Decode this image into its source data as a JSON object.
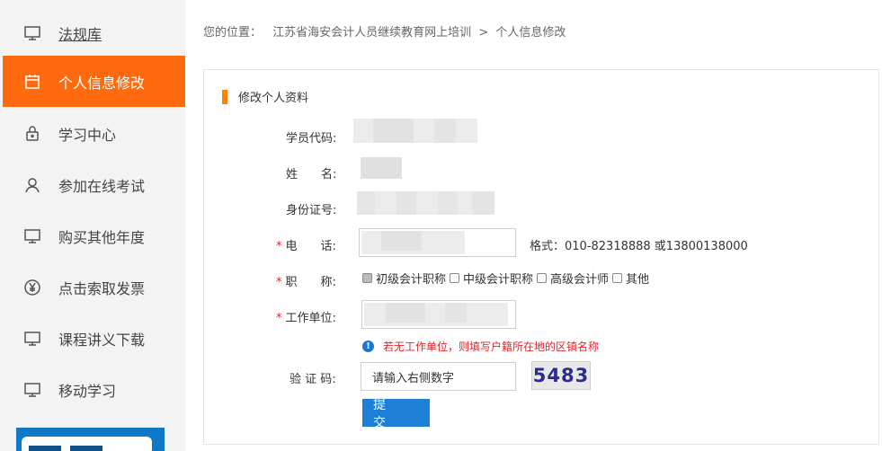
{
  "sidebar": {
    "items": [
      {
        "label": "法规库",
        "icon": "monitor-icon"
      },
      {
        "label": "个人信息修改",
        "icon": "calendar-icon"
      },
      {
        "label": "学习中心",
        "icon": "lock-icon"
      },
      {
        "label": "参加在线考试",
        "icon": "user-icon"
      },
      {
        "label": "购买其他年度",
        "icon": "monitor-icon"
      },
      {
        "label": "点击索取发票",
        "icon": "yen-icon"
      },
      {
        "label": "课程讲义下载",
        "icon": "monitor-icon"
      },
      {
        "label": "移动学习",
        "icon": "monitor-icon"
      }
    ],
    "active_index": 1,
    "accent_color": "#ff6a0f"
  },
  "breadcrumb": {
    "prefix": "您的位置：",
    "site": "江苏省海安会计人员继续教育网上培训",
    "separator": ">",
    "current": "个人信息修改"
  },
  "form": {
    "title": "修改个人资料",
    "student_code_label": "学员代码:",
    "name_label": "姓　　名:",
    "id_label": "身份证号:",
    "phone_label": "电　　话:",
    "phone_hint": "格式：010-82318888 或13800138000",
    "title_label": "职　　称:",
    "title_options": [
      {
        "label": "初级会计职称",
        "checked": true
      },
      {
        "label": "中级会计职称",
        "checked": false
      },
      {
        "label": "高级会计师",
        "checked": false
      },
      {
        "label": "其他",
        "checked": false
      }
    ],
    "employer_label": "工作单位:",
    "employer_hint": "若无工作单位，则填写户籍所在地的区镇名称",
    "captcha_label": "验 证 码:",
    "captcha_placeholder": "请输入右侧数字",
    "captcha_value": "5483",
    "submit_label": "提 交",
    "required_mark": "*"
  }
}
